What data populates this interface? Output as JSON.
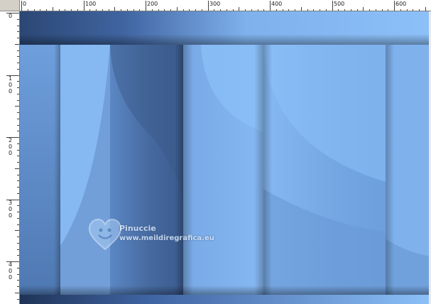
{
  "ruler": {
    "horizontal_labels": [
      "0",
      "100",
      "200",
      "300",
      "400",
      "500",
      "600"
    ],
    "vertical_labels": [
      [
        "0"
      ],
      [
        "1",
        "0",
        "0"
      ],
      [
        "2",
        "0",
        "0"
      ],
      [
        "3",
        "0",
        "0"
      ],
      [
        "4",
        "0",
        "0"
      ]
    ]
  },
  "canvas": {
    "watermark_name": "Pinuccie",
    "watermark_url": "www.meildiregrafica.eu",
    "watermark_icon": "heart-smiley-icon"
  },
  "colors": {
    "ruler_bg": "#ffffff",
    "frame_bg": "#d4d0c8",
    "light_blue": "#86b9f3",
    "mid_blue": "#6b9ad6",
    "dark_blue": "#2c4a7c"
  }
}
